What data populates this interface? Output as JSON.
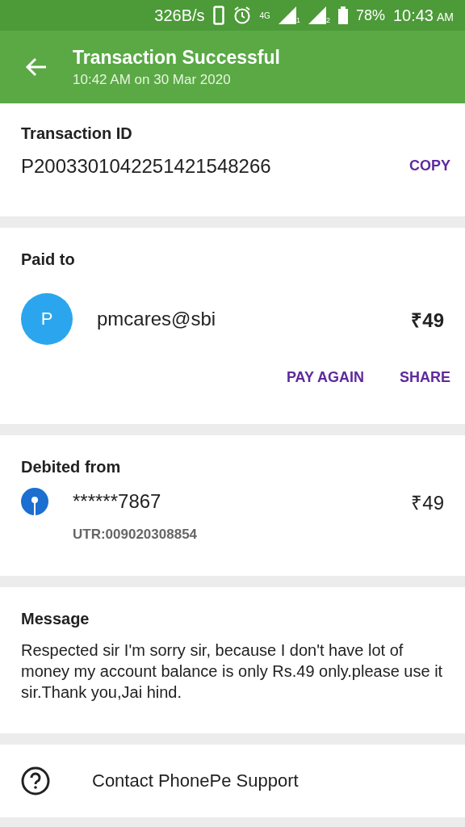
{
  "status_bar": {
    "speed": "326B/s",
    "network": "4G",
    "sim_1": "1",
    "sim_2": "2",
    "battery": "78%",
    "time": "10:43",
    "meridiem": "AM"
  },
  "app_bar": {
    "title": "Transaction Successful",
    "subtitle": "10:42 AM on 30 Mar 2020"
  },
  "transaction": {
    "label": "Transaction ID",
    "id": "P2003301042251421548266",
    "copy": "COPY"
  },
  "paid_to": {
    "label": "Paid to",
    "avatar": "P",
    "payee": "pmcares@sbi",
    "amount": "₹49",
    "actions": [
      "PAY AGAIN",
      "SHARE"
    ]
  },
  "debited_from": {
    "label": "Debited from",
    "account": "******7867",
    "amount": "₹49",
    "utr": "UTR:009020308854"
  },
  "message": {
    "label": "Message",
    "text": "Respected sir I'm sorry sir, because I don't have lot of money my account balance is only Rs.49 only.please use it sir.Thank you,Jai hind."
  },
  "support": {
    "label": "Contact PhonePe Support"
  }
}
